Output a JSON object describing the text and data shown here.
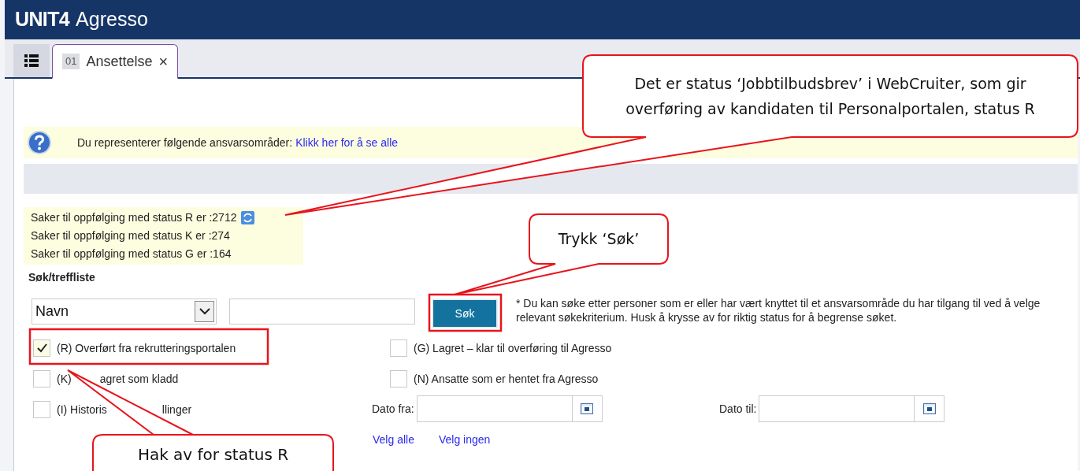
{
  "app": {
    "logo_bold": "UNIT4",
    "logo_text": "Agresso"
  },
  "tabs": [
    {
      "number": "01",
      "label": "Ansettelse",
      "close": "×",
      "selected": true
    }
  ],
  "info_bar": {
    "text": "Du representerer følgende ansvarsområder:",
    "link": "Klikk her for å se alle"
  },
  "status_counts": [
    "Saker til oppfølging med status R er :2712",
    "Saker til oppfølging med status K er :274",
    "Saker til oppfølging med status G er :164"
  ],
  "section_title": "Søk/treffliste",
  "search": {
    "field": "Navn",
    "button": "Søk",
    "note": "* Du kan søke etter personer som er eller har vært knyttet til et ansvarsområde du har tilgang til ved å velge relevant søkekriterium. Husk å krysse av for riktig status for å begrense søket."
  },
  "filters_left": [
    {
      "parts": [
        "(R) Overført fra rekrutteringsportalen"
      ],
      "checked": true
    },
    {
      "parts": [
        "(K)",
        "agret som kladd"
      ],
      "checked": false
    },
    {
      "parts": [
        "(I) Historis",
        "llinger"
      ],
      "checked": false
    }
  ],
  "filters_right": [
    {
      "parts": [
        "(G) Lagret – klar til overføring til Agresso"
      ],
      "checked": false
    },
    {
      "parts": [
        "(N) Ansatte som er hentet fra Agresso"
      ],
      "checked": false
    }
  ],
  "date_fields": [
    {
      "label": "Dato fra:"
    },
    {
      "label": "Dato til:"
    }
  ],
  "links": [
    "Velg alle",
    "Velg ingen"
  ],
  "callouts": [
    {
      "text": "Det er status ‘Jobbtilbudsbrev’ i WebCruiter, som gir overføring av kandidaten til Personalportalen, status R"
    },
    {
      "text": "Trykk ‘Søk’"
    },
    {
      "text": "Hak av for status R"
    }
  ]
}
